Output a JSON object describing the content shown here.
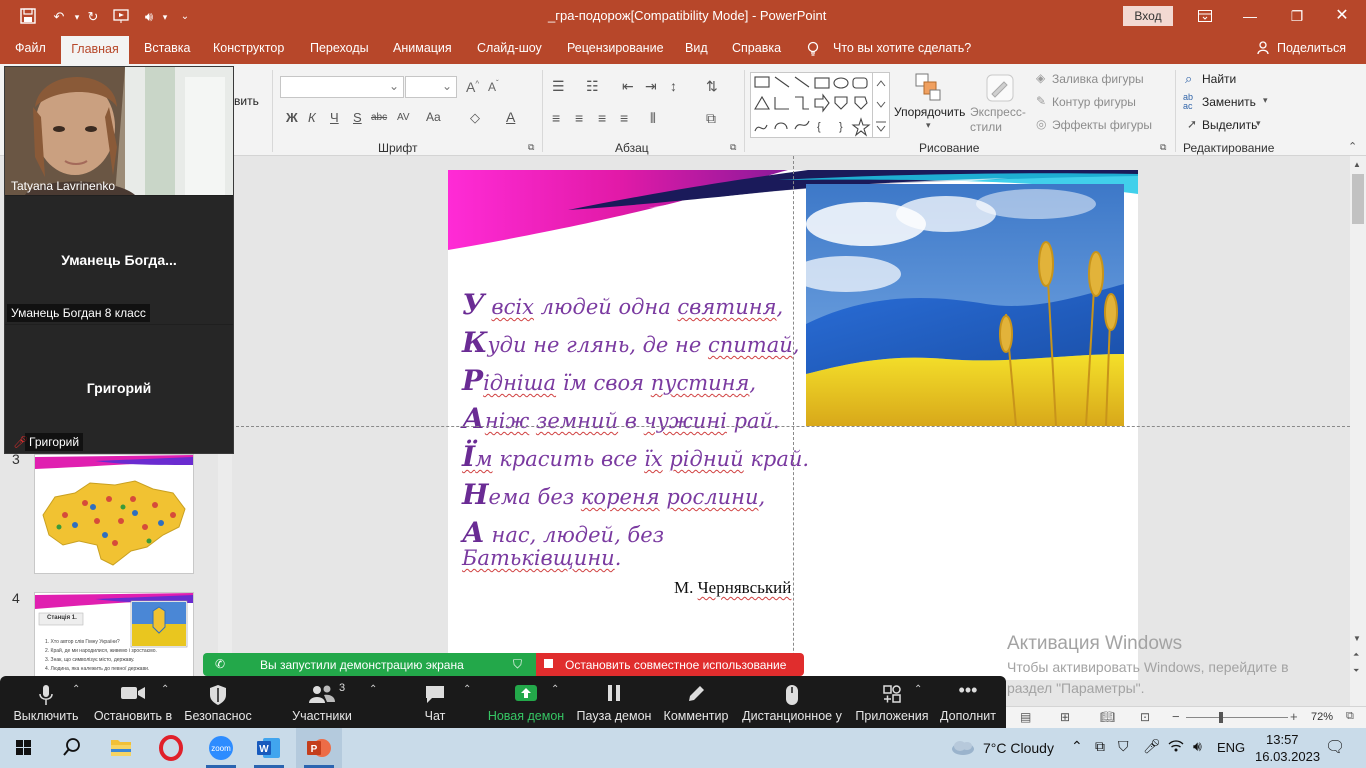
{
  "window": {
    "title": "_гра-подорож[Compatibility Mode]  -  PowerPoint",
    "signin_label": "Вход",
    "share_label": "Поделиться"
  },
  "ribbon_tabs": [
    "Файл",
    "Главная",
    "Вставка",
    "Конструктор",
    "Переходы",
    "Анимация",
    "Слайд-шоу",
    "Рецензирование",
    "Вид",
    "Справка"
  ],
  "tell_me": "Что вы хотите сделать?",
  "ribbon": {
    "groups": {
      "font": "Шрифт",
      "paragraph": "Абзац",
      "drawing": "Рисование",
      "editing": "Редактирование"
    },
    "clipboard_partial": "вить",
    "font_buttons": [
      "Ж",
      "К",
      "Ч",
      "S",
      "abc",
      "AV",
      "Aa"
    ],
    "arrange": "Упорядочить",
    "quick_styles": "Экспресс-стили",
    "shape_fill": "Заливка фигуры",
    "shape_outline": "Контур фигуры",
    "shape_effects": "Эффекты фигуры",
    "find": "Найти",
    "replace": "Заменить",
    "select": "Выделить"
  },
  "thumbnails": [
    {
      "number": "3"
    },
    {
      "number": "4",
      "title": "Станція 1.",
      "lines": [
        "1. Хто автор слів Гімну України?",
        "2. Край, де ми народилися, живемо і зростаємо.",
        "3. Знак, що символізує місто, державу.",
        "4. Людина, яка належить до певної держави."
      ]
    }
  ],
  "slide": {
    "poem": [
      {
        "cap": "У",
        "parts": [
          " ",
          "всіх",
          " людей одна ",
          "святиня",
          ","
        ]
      },
      {
        "cap": "К",
        "parts": [
          "уди не глянь, де не ",
          "спитай",
          ","
        ]
      },
      {
        "cap": "Р",
        "parts": [
          "",
          "ідніша",
          " їм своя ",
          "пустиня",
          ","
        ]
      },
      {
        "cap": "А",
        "parts": [
          "",
          "ніж",
          " ",
          "земний",
          " в ",
          "чужині",
          " рай."
        ]
      },
      {
        "cap": "Ї",
        "parts": [
          "",
          "м",
          " красить все ",
          "їх",
          " ",
          "рідний",
          " край."
        ]
      },
      {
        "cap": "Н",
        "parts": [
          "ема без ",
          "кореня",
          " ",
          "рослини",
          ","
        ]
      },
      {
        "cap": "А",
        "parts": [
          " нас, людей, без",
          "",
          ""
        ]
      },
      {
        "cap": "",
        "parts": [
          "",
          "Батьківщини",
          "."
        ]
      }
    ],
    "author_prefix": "М. ",
    "author_name": "Чернявський"
  },
  "activation": {
    "title": "Активация Windows",
    "text": "Чтобы активировать Windows, перейдите в раздел \"Параметры\"."
  },
  "status": {
    "zoom": "72%"
  },
  "zoom_meeting": {
    "participants": [
      {
        "label": "Tatyana Lavrinenko"
      },
      {
        "display_name": "Уманець  Богда...",
        "label": "Уманець Богдан 8 класс"
      },
      {
        "display_name": "Григорий",
        "label": "Григорий"
      }
    ],
    "share_banner": "Вы запустили демонстрацию экрана",
    "stop_share": "Остановить совместное использование",
    "toolbar": {
      "mute": "Выключить",
      "video": "Остановить в",
      "security": "Безопаснос",
      "participants": "Участники",
      "participants_count": "3",
      "chat": "Чат",
      "new_share": "Новая демон",
      "pause_share": "Пауза демон",
      "annotate": "Комментир",
      "remote": "Дистанционное у",
      "apps": "Приложения",
      "more": "Дополнит"
    },
    "accent_color": "#23a84a",
    "stop_color": "#e02d2d"
  },
  "taskbar": {
    "weather": "7°C  Cloudy",
    "lang": "ENG",
    "time": "13:57",
    "date": "16.03.2023"
  }
}
